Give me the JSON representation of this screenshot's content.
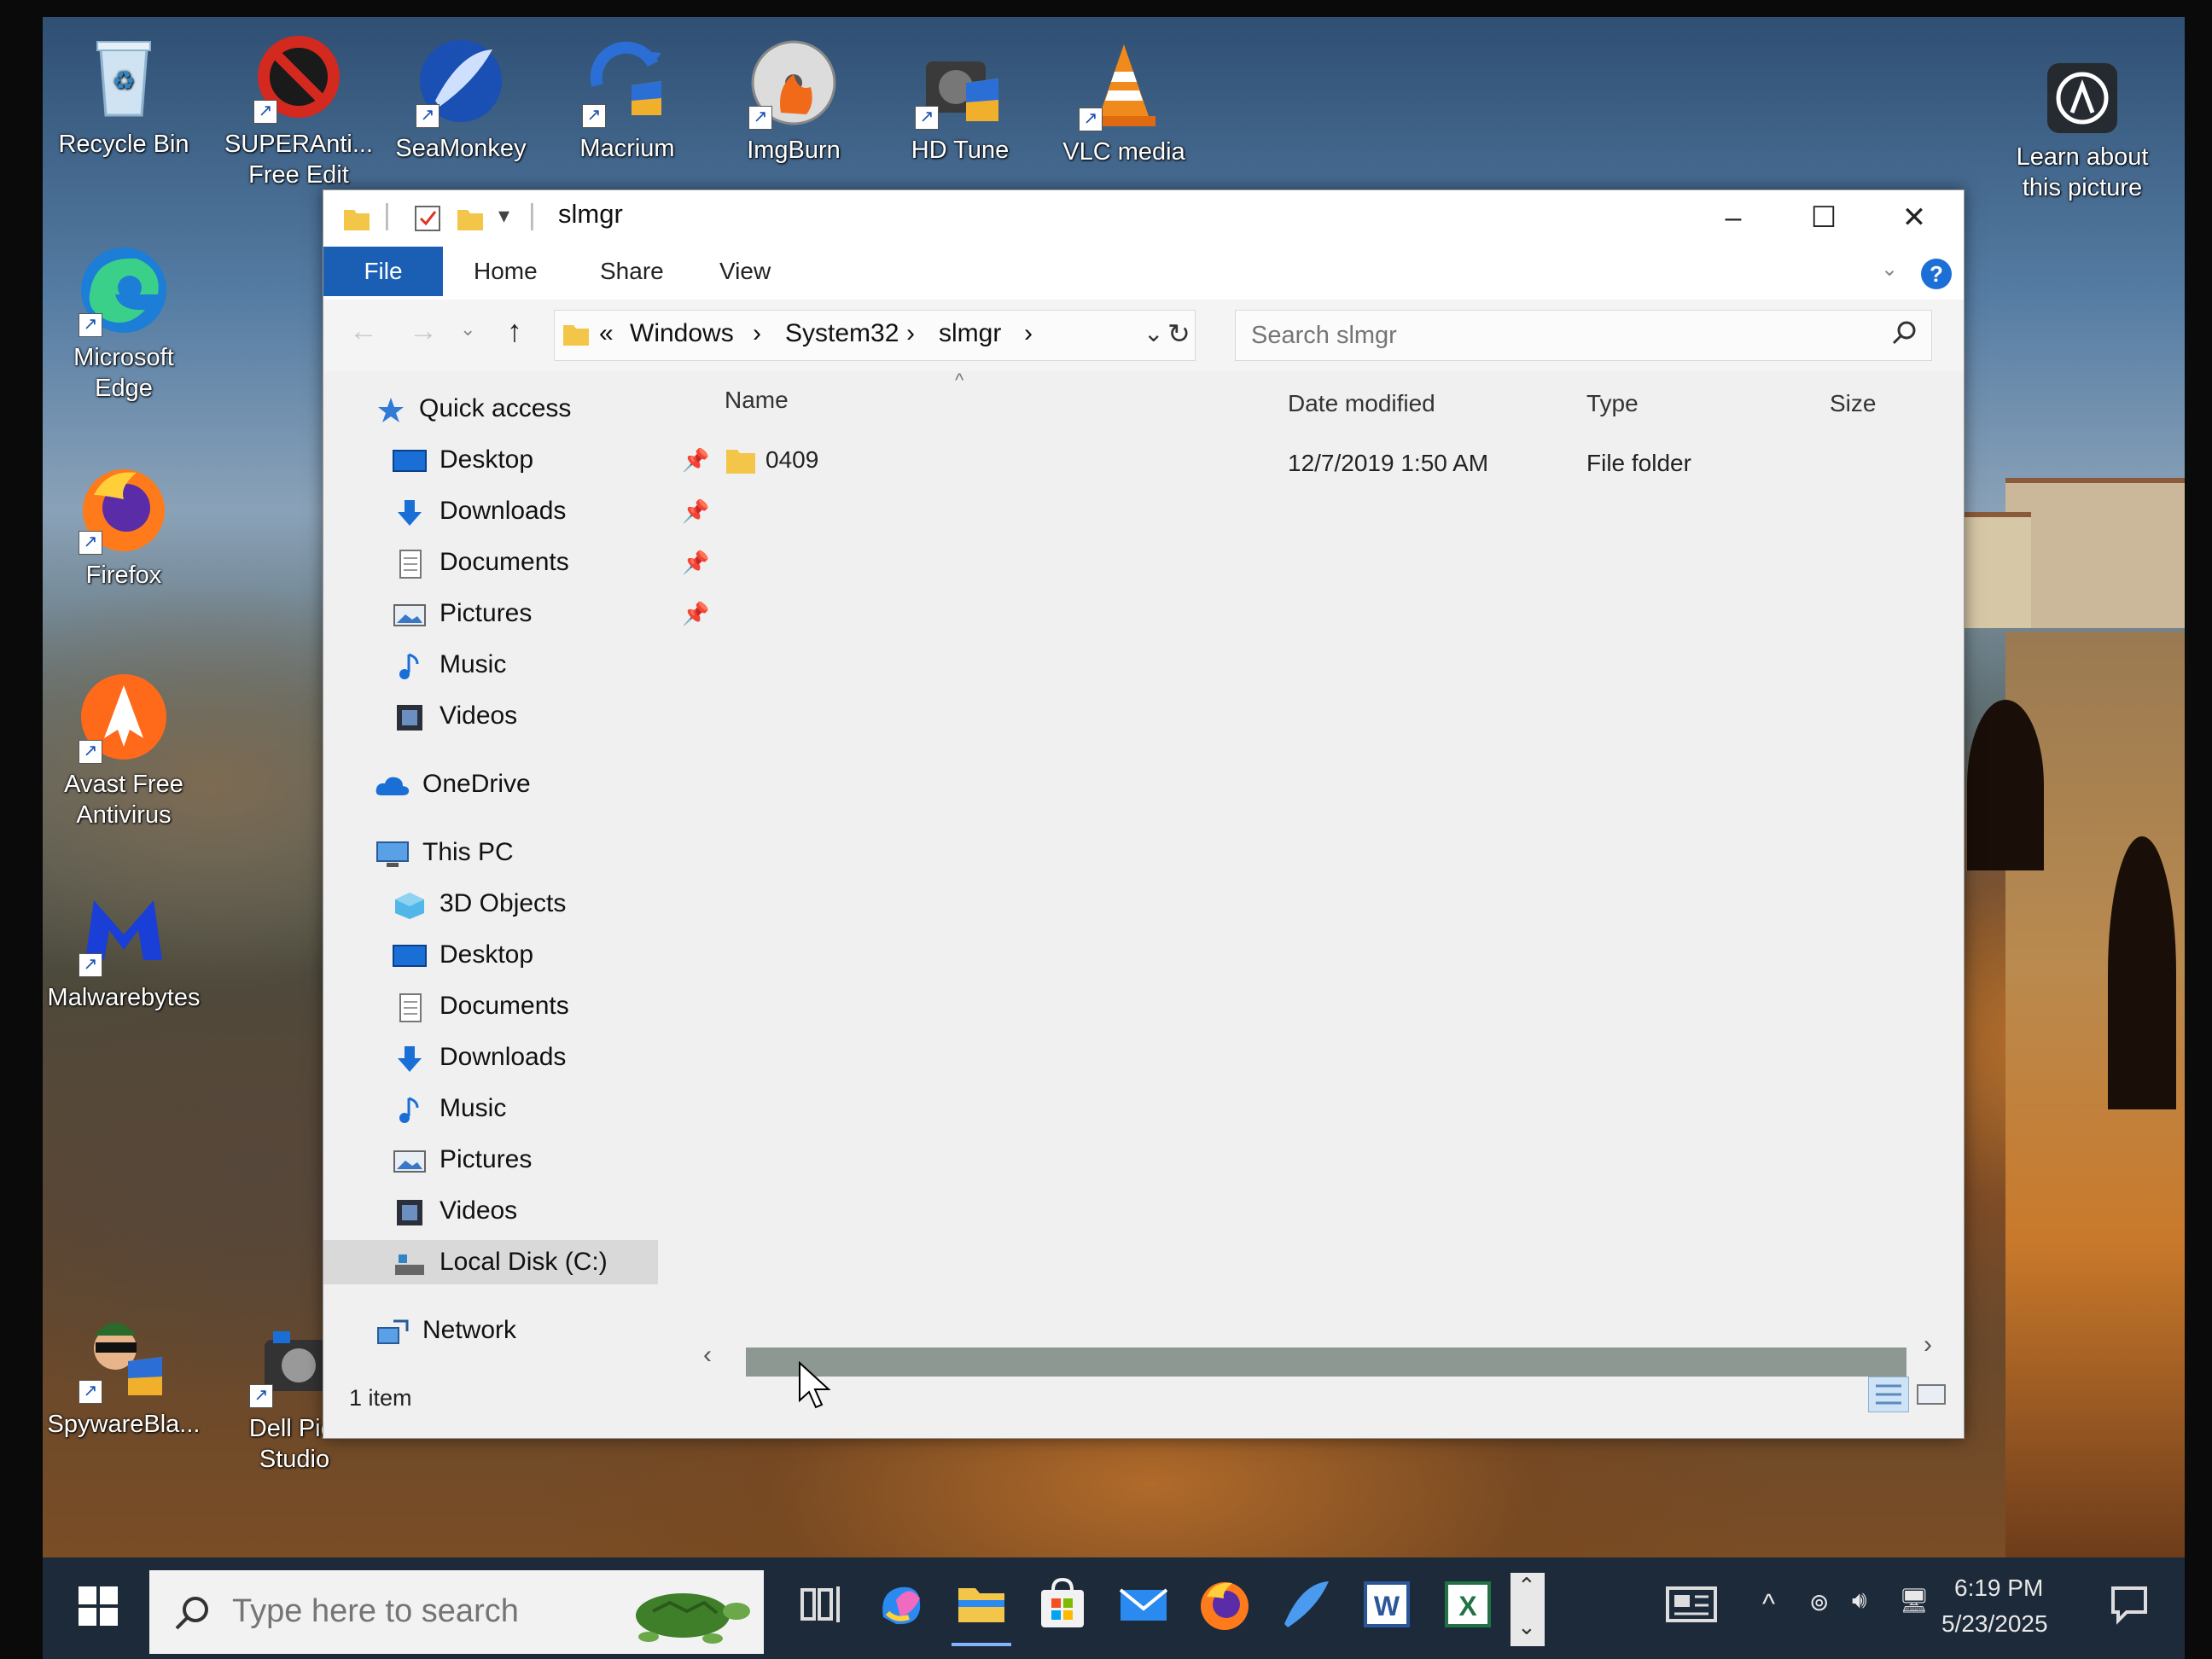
{
  "desktop": {
    "icons": [
      {
        "label": "Recycle Bin"
      },
      {
        "label": "SUPERAnti... Free Edit"
      },
      {
        "label": "SeaMonkey"
      },
      {
        "label": "Macrium"
      },
      {
        "label": "ImgBurn"
      },
      {
        "label": "HD Tune"
      },
      {
        "label": "VLC media"
      },
      {
        "label": "Microsoft Edge"
      },
      {
        "label": "Firefox"
      },
      {
        "label": "Avast Free Antivirus"
      },
      {
        "label": "Malwarebytes"
      },
      {
        "label": "SpywareBla..."
      },
      {
        "label": "Dell Pict Studio"
      }
    ],
    "learn_about": "Learn about this picture"
  },
  "explorer": {
    "title": "slmgr",
    "ribbon_tabs": [
      "File",
      "Home",
      "Share",
      "View"
    ],
    "address": {
      "overflow": "«",
      "crumbs": [
        "Windows",
        "System32",
        "slmgr"
      ],
      "sep": "›"
    },
    "search_placeholder": "Search slmgr",
    "nav": {
      "quick_access": "Quick access",
      "quick_items": [
        "Desktop",
        "Downloads",
        "Documents",
        "Pictures",
        "Music",
        "Videos"
      ],
      "onedrive": "OneDrive",
      "this_pc": "This PC",
      "pc_items": [
        "3D Objects",
        "Desktop",
        "Documents",
        "Downloads",
        "Music",
        "Pictures",
        "Videos",
        "Local Disk (C:)"
      ],
      "network": "Network"
    },
    "columns": {
      "name": "Name",
      "date": "Date modified",
      "type": "Type",
      "size": "Size"
    },
    "rows": [
      {
        "name": "0409",
        "date": "12/7/2019 1:50 AM",
        "type": "File folder",
        "size": ""
      }
    ],
    "status": "1 item"
  },
  "taskbar": {
    "search_placeholder": "Type here to search",
    "time": "6:19 PM",
    "date": "5/23/2025"
  },
  "colors": {
    "accent": "#1b5fb4",
    "folder": "#f3c64a",
    "taskbar": "#1d2a3a"
  }
}
